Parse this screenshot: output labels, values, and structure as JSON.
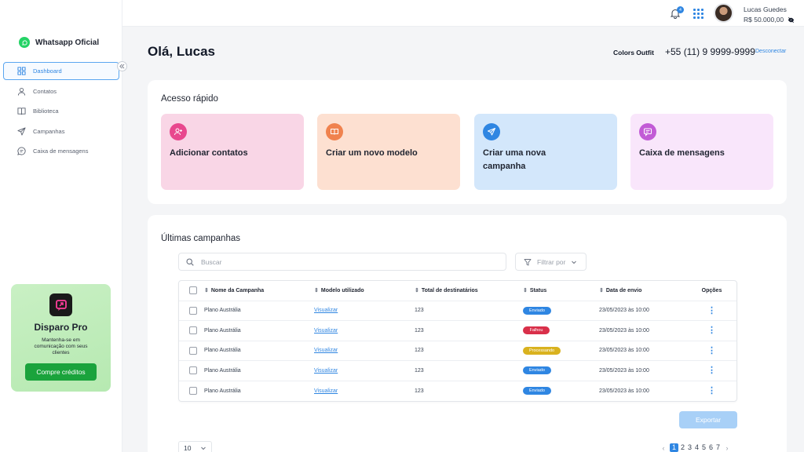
{
  "sidebar": {
    "brand": "Whatsapp Oficial",
    "items": [
      {
        "label": "Dashboard",
        "icon": "dashboard-icon",
        "active": true
      },
      {
        "label": "Contatos",
        "icon": "user-icon"
      },
      {
        "label": "Biblioteca",
        "icon": "book-icon"
      },
      {
        "label": "Campanhas",
        "icon": "send-icon"
      },
      {
        "label": "Caixa de mensagens",
        "icon": "message-icon"
      }
    ],
    "promo": {
      "title": "Disparo Pro",
      "text": "Mantenha-se em comunicação com seus clientes",
      "button": "Compre créditos"
    }
  },
  "topbar": {
    "notifications": "4",
    "user_name": "Lucas Guedes",
    "balance": "R$ 50.000,00"
  },
  "header": {
    "greeting": "Olá, Lucas",
    "company": "Colors Outfit",
    "phone": "+55 (11) 9 9999-9999",
    "disconnect": "Desconectar"
  },
  "quick_access": {
    "title": "Acesso rápido",
    "tiles": [
      {
        "label": "Adicionar contatos",
        "bg": "#f9d6e6",
        "icon_bg": "#e8488e"
      },
      {
        "label": "Criar um novo modelo",
        "bg": "#fde0d1",
        "icon_bg": "#f0824e"
      },
      {
        "label": "Criar uma nova campanha",
        "bg": "#d3e7fb",
        "icon_bg": "#2f86e2"
      },
      {
        "label": "Caixa de mensagens",
        "bg": "#f9e6fb",
        "icon_bg": "#c25bd6"
      }
    ]
  },
  "campaigns": {
    "title": "Últimas campanhas",
    "search_placeholder": "Buscar",
    "filter_label": "Filtrar por",
    "columns": [
      "Nome da Campanha",
      "Modelo utilizado",
      "Total de destinatários",
      "Status",
      "Data de envio",
      "Opções"
    ],
    "rows": [
      {
        "name": "Plano Austrália",
        "model": "Visualizar",
        "total": "123",
        "status": "Enviado",
        "status_color": "#2f86e2",
        "date": "23/05/2023 às 10:00"
      },
      {
        "name": "Plano Austrália",
        "model": "Visualizar",
        "total": "123",
        "status": "Falhou",
        "status_color": "#d9304a",
        "date": "23/05/2023 às 10:00"
      },
      {
        "name": "Plano Austrália",
        "model": "Visualizar",
        "total": "123",
        "status": "Processando",
        "status_color": "#d9b21f",
        "date": "23/05/2023 às 10:00"
      },
      {
        "name": "Plano Austrália",
        "model": "Visualizar",
        "total": "123",
        "status": "Enviado",
        "status_color": "#2f86e2",
        "date": "23/05/2023 às 10:00"
      },
      {
        "name": "Plano Austrália",
        "model": "Visualizar",
        "total": "123",
        "status": "Enviado",
        "status_color": "#2f86e2",
        "date": "23/05/2023 às 10:00"
      }
    ],
    "export": "Exportar",
    "per_page": "10",
    "pages": [
      "1",
      "2",
      "3",
      "4",
      "5",
      "6",
      "7"
    ],
    "current_page": "1"
  }
}
